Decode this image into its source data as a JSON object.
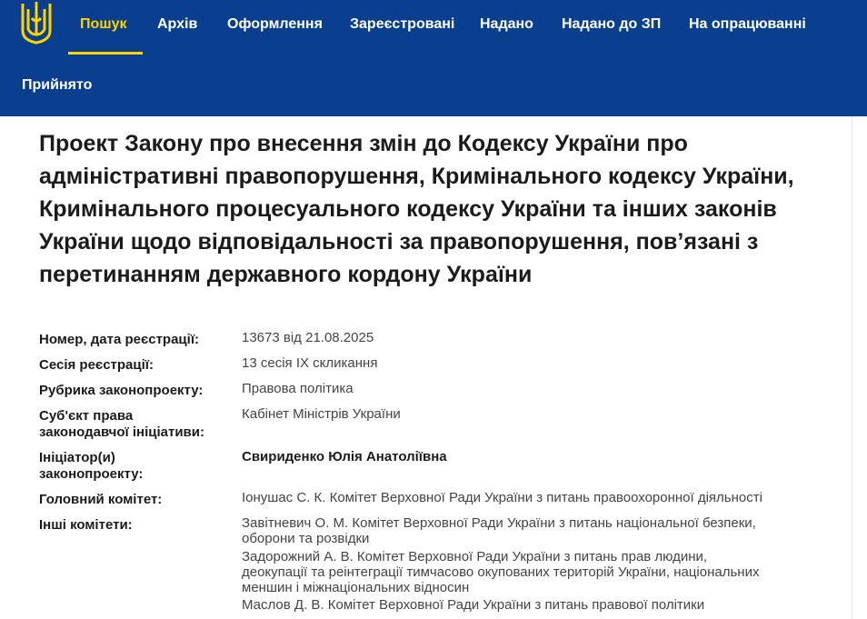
{
  "nav": {
    "items": [
      {
        "label": "Пошук"
      },
      {
        "label": "Архів"
      },
      {
        "label": "Оформлення"
      },
      {
        "label": "Зареєстровані"
      },
      {
        "label": "Надано"
      },
      {
        "label": "Надано до ЗП"
      },
      {
        "label": "На опрацюванні"
      },
      {
        "label": "Прийнято"
      }
    ],
    "active_index": 0
  },
  "colors": {
    "header_bg": "#0a3f8f",
    "accent": "#ffd200",
    "logo_icon": "tryzub-icon"
  },
  "bill": {
    "title": "Проект Закону про внесення змін до Кодексу України про адміністративні правопорушення, Кримінального кодексу України, Кримінального процесуального кодексу України та інших законів України щодо відповідальності за правопорушення, пов’язані з перетинанням державного кордону України"
  },
  "details": {
    "reg_label": "Номер, дата реєстрації:",
    "reg_value": "13673 від 21.08.2025",
    "session_label": "Сесія реєстрації:",
    "session_value": "13 сесія IX скликання",
    "rubric_label": "Рубрика законопроекту:",
    "rubric_value": "Правова політика",
    "subject_label_1": "Суб'єкт права",
    "subject_label_2": "законодавчої ініціативи:",
    "subject_value": "Кабінет Міністрів України",
    "initiator_label_1": "Ініціатор(и)",
    "initiator_label_2": "законопроекту:",
    "initiator_value": "Свириденко Юлія Анатоліївна",
    "main_committee_label": "Головний комітет:",
    "main_committee_value": "Іонушас С. К. Комітет Верховної Ради України з питань правоохоронної діяльності",
    "other_committees_label": "Інші комітети:",
    "other_committees": [
      "Завітневич О. М. Комітет Верховної Ради України з питань національної безпеки,",
      "оборони та розвідки",
      "Задорожний А. В. Комітет Верховної Ради України з питань прав людини,",
      "деокупації та реінтеграції тимчасово окупованих територій України, національних",
      "меншин і міжнаціональних відносин",
      "Маслов Д. В. Комітет Верховної Ради України з питань правової політики"
    ]
  }
}
